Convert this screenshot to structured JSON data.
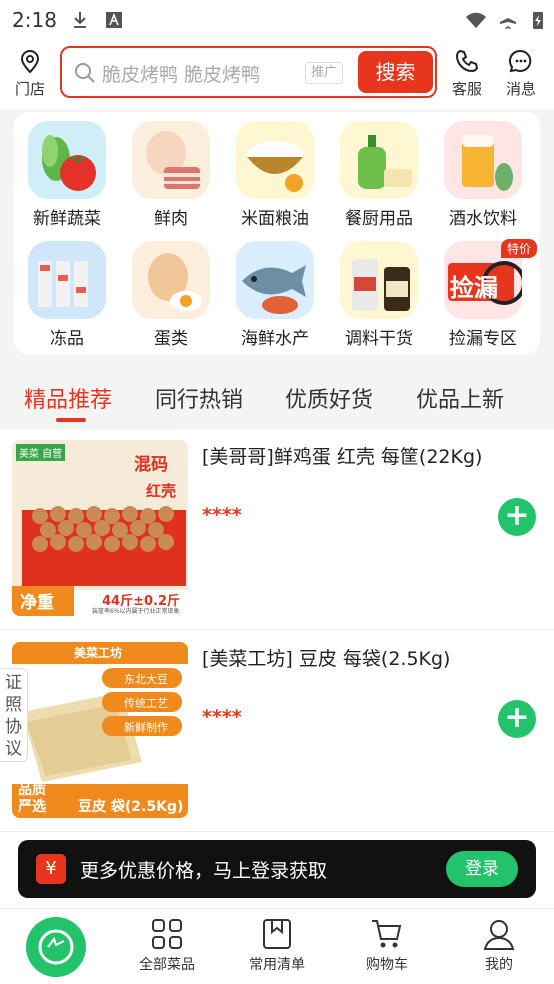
{
  "status_bar": {
    "time": "2:18"
  },
  "header": {
    "store_label": "门店",
    "search_placeholder": "脆皮烤鸭 脆皮烤鸭",
    "ad_tag": "推广",
    "search_button": "搜索",
    "service_label": "客服",
    "message_label": "消息"
  },
  "categories": [
    {
      "label": "新鲜蔬菜",
      "icon": "vegetables-icon"
    },
    {
      "label": "鲜肉",
      "icon": "meat-icon"
    },
    {
      "label": "米面粮油",
      "icon": "rice-icon"
    },
    {
      "label": "餐厨用品",
      "icon": "kitchen-supplies-icon"
    },
    {
      "label": "酒水饮料",
      "icon": "beer-icon"
    },
    {
      "label": "冻品",
      "icon": "frozen-icon"
    },
    {
      "label": "蛋类",
      "icon": "egg-icon"
    },
    {
      "label": "海鲜水产",
      "icon": "seafood-icon"
    },
    {
      "label": "调料干货",
      "icon": "condiment-icon"
    },
    {
      "label": "捡漏专区",
      "icon": "bargain-icon",
      "badge": "特价",
      "img_text": "捡漏"
    }
  ],
  "tabs": [
    "精品推荐",
    "同行热销",
    "优质好货",
    "优品上新"
  ],
  "active_tab": 0,
  "products": [
    {
      "title": "[美哥哥]鲜鸡蛋 红壳 每筐(22Kg)",
      "price": "****",
      "img": {
        "brand": "美菜 自营",
        "tag1": "混码",
        "tag2": "红壳",
        "corner": "净重",
        "weight": "44斤±0.2斤",
        "note": "装筐率6%以内属于行业正常现象"
      }
    },
    {
      "title": "[美菜工坊] 豆皮 每袋(2.5Kg)",
      "price": "****",
      "img": {
        "brand": "美菜工坊",
        "f1": "东北大豆",
        "f2": "传统工艺",
        "f3": "新鲜制作",
        "corner": "品质严选",
        "name": "豆皮 袋(2.5Kg)"
      }
    }
  ],
  "side_tab": "证照协议",
  "login_banner": {
    "text": "更多优惠价格，马上登录获取",
    "button": "登录",
    "icon": "¥"
  },
  "nav": [
    {
      "label": "全部菜品",
      "icon": "grid-icon"
    },
    {
      "label": "常用清单",
      "icon": "list-icon"
    },
    {
      "label": "购物车",
      "icon": "cart-icon"
    },
    {
      "label": "我的",
      "icon": "user-icon"
    }
  ],
  "colors": {
    "accent": "#e8361e",
    "green": "#22c36a"
  }
}
